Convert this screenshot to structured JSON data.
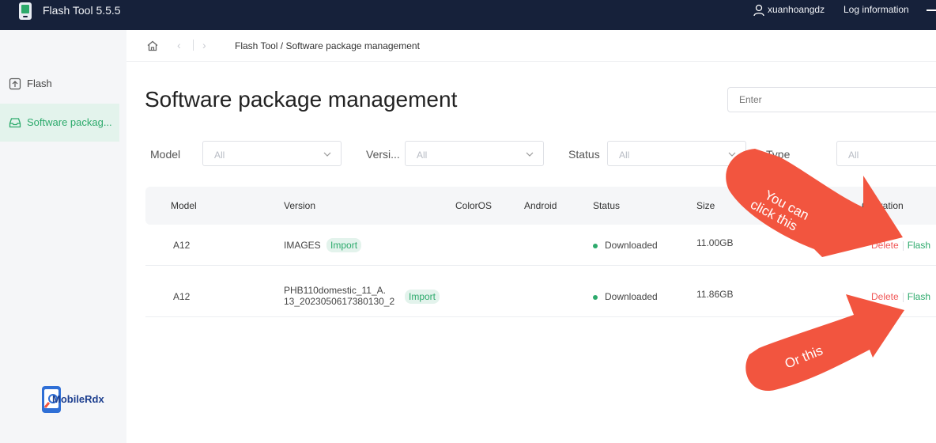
{
  "titlebar": {
    "app_title": "Flash Tool 5.5.5",
    "user_name": "xuanhoangdz",
    "log_information": "Log information"
  },
  "sidebar": {
    "items": [
      {
        "label": "Flash",
        "icon": "upload-icon",
        "active": false
      },
      {
        "label": "Software packag...",
        "icon": "inbox-icon",
        "active": true
      }
    ]
  },
  "breadcrumb": {
    "text": "Flash Tool / Software package management"
  },
  "page": {
    "title": "Software package management",
    "search_placeholder": "Enter"
  },
  "filters": [
    {
      "label": "Model",
      "value": "All"
    },
    {
      "label": "Versi...",
      "value": "All"
    },
    {
      "label": "Status",
      "value": "All"
    },
    {
      "label": "Type",
      "value": "All"
    }
  ],
  "table": {
    "headers": [
      "Model",
      "Version",
      "ColorOS",
      "Android",
      "Status",
      "Size",
      "Operation"
    ],
    "rows": [
      {
        "model": "A12",
        "version_line1": "IMAGES",
        "version_line2": "",
        "tag": "Import",
        "coloros": "",
        "android": "",
        "status": "Downloaded",
        "size": "11.00GB",
        "delete": "Delete",
        "flash": "Flash"
      },
      {
        "model": "A12",
        "version_line1": "PHB110domestic_11_A.",
        "version_line2": "13_2023050617380130_2",
        "tag": "Import",
        "coloros": "",
        "android": "",
        "status": "Downloaded",
        "size": "11.86GB",
        "delete": "Delete",
        "flash": "Flash"
      }
    ]
  },
  "annotations": {
    "arrow1_line1": "You can",
    "arrow1_line2": "click this",
    "arrow2": "Or this"
  },
  "logo": {
    "text": "MobileRdx"
  },
  "colors": {
    "titlebar": "#16213a",
    "accent_green": "#2daa6c",
    "delete_red": "#f05656",
    "annotation_orange": "#f2553f"
  }
}
